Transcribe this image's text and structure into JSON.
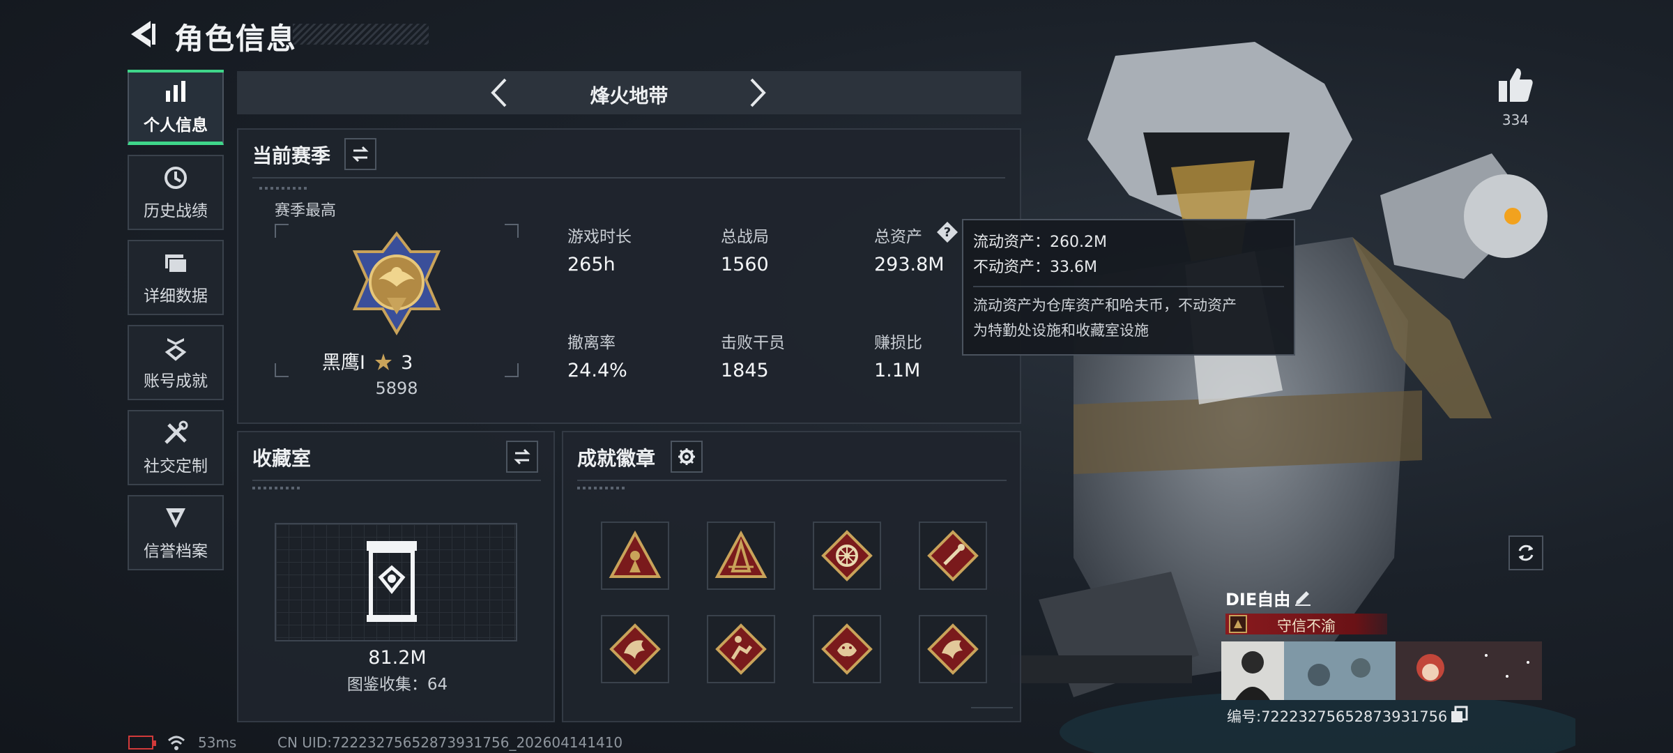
{
  "header": {
    "title": "角色信息"
  },
  "sidebar": {
    "items": [
      {
        "label": "个人信息",
        "icon": "bar-chart-icon",
        "active": true
      },
      {
        "label": "历史战绩",
        "icon": "clock-icon"
      },
      {
        "label": "详细数据",
        "icon": "folder-icon"
      },
      {
        "label": "账号成就",
        "icon": "achievement-icon"
      },
      {
        "label": "社交定制",
        "icon": "tools-icon"
      },
      {
        "label": "信誉档案",
        "icon": "reputation-icon"
      }
    ]
  },
  "mode": {
    "name": "烽火地带"
  },
  "season": {
    "title": "当前赛季",
    "subtitle": "赛季最高",
    "rank_name": "黑鹰I",
    "rank_stars": "3",
    "rank_score": "5898",
    "stats": [
      {
        "label": "游戏时长",
        "value": "265h"
      },
      {
        "label": "总战局",
        "value": "1560"
      },
      {
        "label": "总资产",
        "value": "293.8M"
      },
      {
        "label": "撤离率",
        "value": "24.4%"
      },
      {
        "label": "击败干员",
        "value": "1845"
      },
      {
        "label": "赚损比",
        "value": "1.1M"
      }
    ]
  },
  "tooltip": {
    "liquid": "流动资产：260.2M",
    "fixed": "不动资产：33.6M",
    "desc_line1": "流动资产为仓库资产和哈夫币，不动资产",
    "desc_line2": "为特勤处设施和收藏室设施"
  },
  "collection": {
    "title": "收藏室",
    "value": "81.2M",
    "catalog": "图鉴收集：64"
  },
  "badges": {
    "title": "成就徽章",
    "items": [
      {
        "icon": "soldier-triangle-badge-icon",
        "color": "#7a1a1c"
      },
      {
        "icon": "tower-triangle-badge-icon",
        "color": "#7a1a1c"
      },
      {
        "icon": "wheel-diamond-badge-icon",
        "color": "#7a1a1c"
      },
      {
        "icon": "tool-diamond-badge-icon",
        "color": "#7a1a1c"
      },
      {
        "icon": "dragon-diamond-badge-icon",
        "color": "#7a1a1c"
      },
      {
        "icon": "runner-diamond-badge-icon",
        "color": "#7a1a1c"
      },
      {
        "icon": "beast-diamond-badge-icon",
        "color": "#7a1a1c"
      },
      {
        "icon": "dragon-diamond-badge-icon",
        "color": "#7a1a1c"
      }
    ]
  },
  "likes": {
    "count": "334"
  },
  "player": {
    "name": "DIE自由",
    "title": "守信不渝",
    "id": "编号:72223275652873931756"
  },
  "status": {
    "ping": "53ms",
    "uid": "CN UID:72223275652873931756_202604141410"
  },
  "colors": {
    "accent_green": "#3fd68a",
    "gold": "#c9a35a",
    "badge_red": "#7a1a1c",
    "battery_red": "#d23a3a"
  }
}
